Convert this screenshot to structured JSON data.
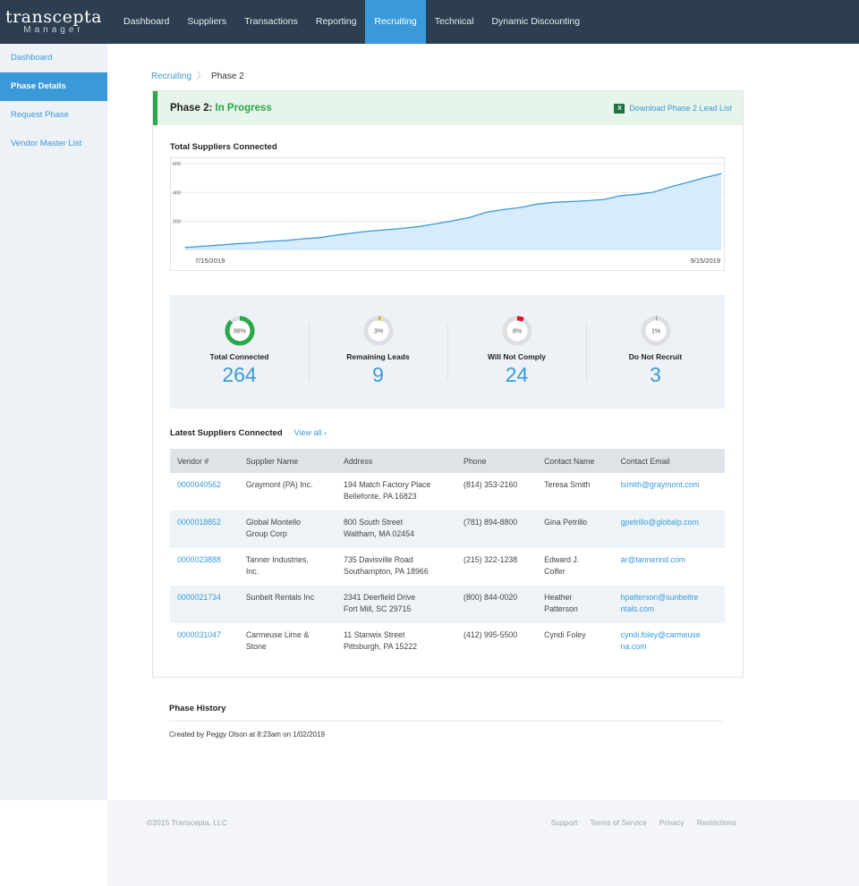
{
  "brand": {
    "name": "transcepta",
    "sub": "Manager"
  },
  "nav": [
    {
      "label": "Dashboard",
      "active": false
    },
    {
      "label": "Suppliers",
      "active": false
    },
    {
      "label": "Transactions",
      "active": false
    },
    {
      "label": "Reporting",
      "active": false
    },
    {
      "label": "Recruiting",
      "active": true
    },
    {
      "label": "Technical",
      "active": false
    },
    {
      "label": "Dynamic Discounting",
      "active": false
    }
  ],
  "sidebar": [
    {
      "label": "Dashboard",
      "active": false
    },
    {
      "label": "Phase Details",
      "active": true
    },
    {
      "label": "Request Phase",
      "active": false
    },
    {
      "label": "Vendor Master List",
      "active": false
    }
  ],
  "breadcrumb": {
    "parent": "Recruiting",
    "sep": "〉",
    "current": "Phase 2"
  },
  "phase": {
    "title": "Phase 2:",
    "status": "In Progress",
    "download": "Download Phase 2 Lead List",
    "download_icon": "excel-icon"
  },
  "chart_section_title": "Total Suppliers Connected",
  "chart_data": {
    "type": "area",
    "title": "Total Suppliers Connected",
    "x_start_label": "7/15/2019",
    "x_end_label": "9/15/2019",
    "y_ticks": [
      200,
      400,
      600
    ],
    "ylim": [
      0,
      600
    ],
    "values": [
      20,
      28,
      36,
      45,
      52,
      62,
      68,
      80,
      88,
      105,
      120,
      133,
      142,
      152,
      165,
      185,
      205,
      228,
      265,
      282,
      296,
      320,
      332,
      337,
      343,
      352,
      378,
      388,
      403,
      440,
      470,
      503,
      530
    ],
    "grid": true,
    "fill_color": "#d6ebfb",
    "line_color": "#3a9ad9"
  },
  "stats": [
    {
      "label": "Total Connected",
      "value": "264",
      "percent": 88,
      "percent_label": "88%",
      "color": "#2aa84a"
    },
    {
      "label": "Remaining Leads",
      "value": "9",
      "percent": 3,
      "percent_label": "3%",
      "color": "#f0a830"
    },
    {
      "label": "Will Not Comply",
      "value": "24",
      "percent": 8,
      "percent_label": "8%",
      "color": "#d0192a"
    },
    {
      "label": "Do Not Recruit",
      "value": "3",
      "percent": 1,
      "percent_label": "1%",
      "color": "#999999"
    }
  ],
  "latest": {
    "title": "Latest Suppliers Connected",
    "view_all": "View all ›"
  },
  "table": {
    "columns": [
      "Vendor #",
      "Supplier Name",
      "Address",
      "Phone",
      "Contact Name",
      "Contact Email"
    ],
    "rows": [
      {
        "vendor": "0000040562",
        "name": [
          "Graymont (PA) Inc."
        ],
        "address": [
          "194 Match Factory Place",
          "Bellefonte, PA 16823"
        ],
        "phone": "(814) 353-2160",
        "contact": [
          "Teresa Smith"
        ],
        "email": [
          "tsmith@graymont.com"
        ]
      },
      {
        "vendor": "0000018852",
        "name": [
          "Global Montello",
          "Group Corp"
        ],
        "address": [
          "800 South Street",
          "Waltham, MA 02454"
        ],
        "phone": "(781) 894-8800",
        "contact": [
          "Gina Petrillo"
        ],
        "email": [
          "gpetrillo@globalp.com"
        ]
      },
      {
        "vendor": "0000023888",
        "name": [
          "Tanner Industries,",
          "Inc."
        ],
        "address": [
          "735 Davisville Road",
          "Southampton, PA 18966"
        ],
        "phone": "(215) 322-1238",
        "contact": [
          "Edward J.",
          "Colfer"
        ],
        "email": [
          "ar@tannerind.com"
        ]
      },
      {
        "vendor": "0000021734",
        "name": [
          "Sunbelt Rentals Inc"
        ],
        "address": [
          "2341 Deerfield Drive",
          "Fort Mill, SC 29715"
        ],
        "phone": "(800) 844-0020",
        "contact": [
          "Heather",
          "Patterson"
        ],
        "email": [
          "hpatterson@sunbeltre",
          "ntals.com"
        ]
      },
      {
        "vendor": "0000031047",
        "name": [
          "Carmeuse Lime &",
          "Stone"
        ],
        "address": [
          "11 Stanwix Street",
          "Pittsburgh, PA 15222"
        ],
        "phone": "(412) 995-5500",
        "contact": [
          "Cyndi Foley"
        ],
        "email": [
          "cyndi.foley@carmeuse",
          "na.com"
        ]
      }
    ]
  },
  "history": {
    "title": "Phase History",
    "text": "Created by Peggy Olson at 8:23am on 1/02/2019"
  },
  "footer": {
    "copyright": "©2015 Transcepta, LLC",
    "links": [
      "Support",
      "Terms of Service",
      "Privacy",
      "Restrictions"
    ]
  }
}
